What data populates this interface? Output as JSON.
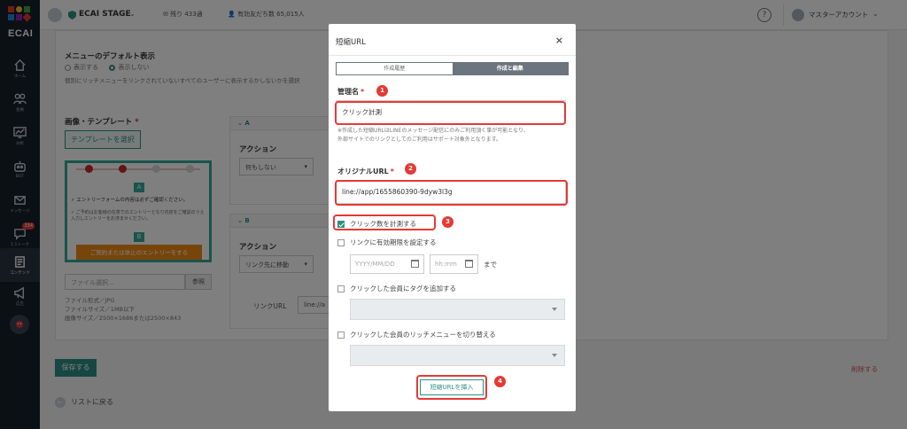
{
  "sidebar": {
    "logo_text": "ECAI",
    "items": [
      {
        "label": "ホーム",
        "icon": "home-icon"
      },
      {
        "label": "会員",
        "icon": "members-icon"
      },
      {
        "label": "分析",
        "icon": "analytics-icon"
      },
      {
        "label": "BOT",
        "icon": "bot-icon"
      },
      {
        "label": "メッセージ",
        "icon": "message-icon"
      },
      {
        "label": "1:1トーク",
        "icon": "chat-icon",
        "badge": "334"
      },
      {
        "label": "コンテンツ",
        "icon": "content-icon",
        "active": true
      },
      {
        "label": "広告",
        "icon": "megaphone-icon"
      }
    ]
  },
  "topbar": {
    "account_name": "ECAI STAGE",
    "mail_remaining": "残り 433通",
    "friends": "有効友だち数 65,015人",
    "help": "?",
    "user_name": "マスターアカウント"
  },
  "page": {
    "menu_default_title": "メニューのデフォルト表示",
    "radio_show": "表示する",
    "radio_hide": "表示しない",
    "menu_default_desc": "個別にリッチメニューをリンクされていないすべてのユーザーに表示するかしないかを選択",
    "image_template_label": "画像・テンプレート",
    "select_template_btn": "テンプレートを選択",
    "thumb_line1": "✓ エントリーフォームの内容は必ずご確認ください。",
    "thumb_line2": "✓ ご予約はお客様の任意でのエントリーとなり内容をご確認のうえ入力しエントリーをお済ませください。",
    "thumb_button": "ご契約または休止のエントリーをする",
    "file_placeholder": "ファイル選択…",
    "file_btn": "参照",
    "file_notes": [
      "ファイル形式／JPG",
      "ファイルサイズ／1MB以下",
      "画像サイズ／2500×1686または2500×843"
    ],
    "panel_a": "A",
    "panel_b": "B",
    "action_label": "アクション",
    "action_a_value": "何もしない",
    "action_b_value": "リンク先に移動",
    "link_url_label": "リンクURL",
    "link_url_value": "line://a",
    "save_btn": "保存する",
    "delete_link": "削除する",
    "back_link": "リストに戻る"
  },
  "modal": {
    "title": "短縮URL",
    "close": "×",
    "tabs": [
      "作成履歴",
      "作成と編集"
    ],
    "admin_name_label": "管理名",
    "admin_name_value": "クリック計測",
    "note_line1": "※作成した短縮URLはLINEのメッセージ配信にのみご利用頂く事が可能となり、",
    "note_line2": "外部サイトでのリンクとしてのご利用はサポート対象外となります。",
    "original_url_label": "オリジナルURL",
    "original_url_value": "line://app/1655860390-9dyw3l3g",
    "count_clicks": "クリック数を計測する",
    "set_expiry": "リンクに有効期限を設定する",
    "date_placeholder": "YYYY/MM/DD",
    "time_placeholder": "hh:mm",
    "until": "まで",
    "add_tag": "クリックした会員にタグを追加する",
    "switch_menu": "クリックした会員のリッチメニューを切り替える",
    "insert_btn": "短縮URLを挿入",
    "required_mark": "*",
    "markers": [
      "1",
      "2",
      "3",
      "4"
    ]
  },
  "colors": {
    "accent": "#2f8f84",
    "highlight": "#e53935",
    "sidebar_bg": "#17212b"
  }
}
